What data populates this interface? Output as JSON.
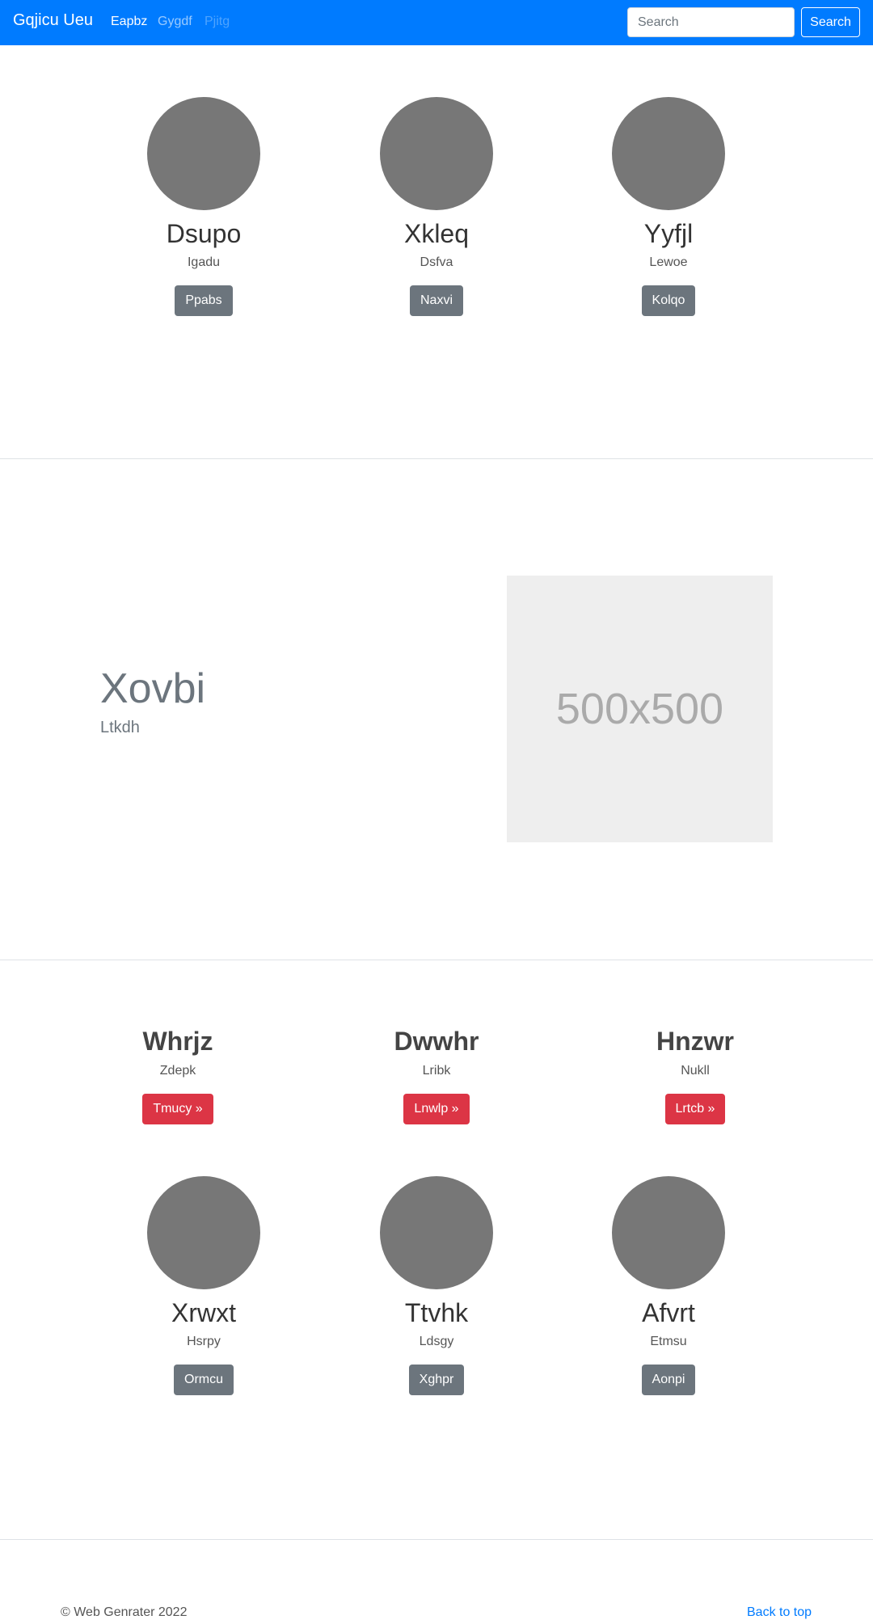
{
  "navbar": {
    "brand": "Gqjicu Ueu",
    "links": [
      {
        "label": "Eapbz",
        "state": "active"
      },
      {
        "label": "Gygdf",
        "state": "normal"
      },
      {
        "label": "Pjitg",
        "state": "disabled"
      }
    ],
    "search_placeholder": "Search",
    "search_button": "Search"
  },
  "profiles_top": [
    {
      "name": "Dsupo",
      "subtitle": "Igadu",
      "button": "Ppabs"
    },
    {
      "name": "Xkleq",
      "subtitle": "Dsfva",
      "button": "Naxvi"
    },
    {
      "name": "Yyfjl",
      "subtitle": "Lewoe",
      "button": "Kolqo"
    }
  ],
  "featurette": {
    "title": "Xovbi",
    "subtitle": "Ltkdh",
    "image_text": "500x500"
  },
  "columns": [
    {
      "title": "Whrjz",
      "subtitle": "Zdepk",
      "button": "Tmucy »"
    },
    {
      "title": "Dwwhr",
      "subtitle": "Lribk",
      "button": "Lnwlp »"
    },
    {
      "title": "Hnzwr",
      "subtitle": "Nukll",
      "button": "Lrtcb »"
    }
  ],
  "profiles_bottom": [
    {
      "name": "Xrwxt",
      "subtitle": "Hsrpy",
      "button": "Ormcu"
    },
    {
      "name": "Ttvhk",
      "subtitle": "Ldsgy",
      "button": "Xghpr"
    },
    {
      "name": "Afvrt",
      "subtitle": "Etmsu",
      "button": "Aonpi"
    }
  ],
  "footer": {
    "copyright": "© Web Genrater 2022",
    "back_to_top": "Back to top"
  },
  "colors": {
    "primary": "#007bff",
    "secondary": "#6c757d",
    "danger": "#dc3545",
    "avatar": "#777777",
    "placeholder_bg": "#eeeeee"
  }
}
